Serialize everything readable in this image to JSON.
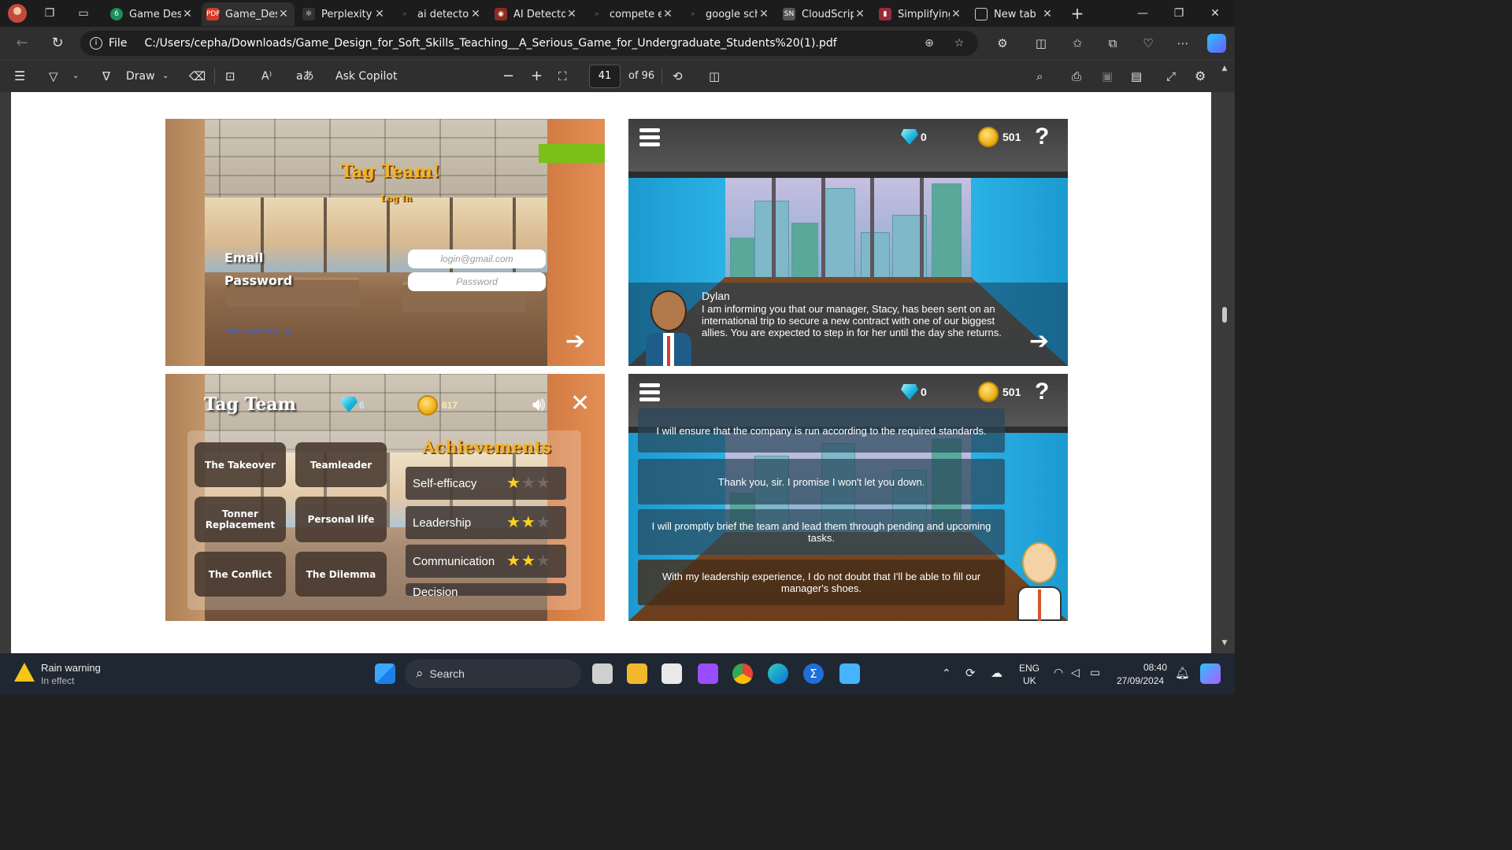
{
  "browser": {
    "tabs": [
      {
        "label": "Game Desi",
        "icon": "edge-logo-icon",
        "active": false
      },
      {
        "label": "Game_Des",
        "icon": "pdf-icon",
        "active": true
      },
      {
        "label": "Perplexity",
        "icon": "perplexity-icon",
        "active": false
      },
      {
        "label": "ai detector",
        "icon": "search-icon",
        "active": false
      },
      {
        "label": "AI Detecto",
        "icon": "ai-detector-icon",
        "active": false
      },
      {
        "label": "compete e",
        "icon": "search-icon",
        "active": false
      },
      {
        "label": "google sch",
        "icon": "search-icon",
        "active": false
      },
      {
        "label": "CloudScrip",
        "icon": "cloudscript-icon",
        "active": false
      },
      {
        "label": "Simplifying",
        "icon": "simplifying-icon",
        "active": false
      },
      {
        "label": "New tab",
        "icon": "new-tab-icon",
        "active": false
      }
    ],
    "address": {
      "scheme": "File",
      "url": "C:/Users/cepha/Downloads/Game_Design_for_Soft_Skills_Teaching__A_Serious_Game_for_Undergraduate_Students%20(1).pdf"
    }
  },
  "pdf_toolbar": {
    "draw_label": "Draw",
    "ask_copilot_label": "Ask Copilot",
    "page_current": "41",
    "page_total": "of 96"
  },
  "document": {
    "login_panel": {
      "title": "Tag Team!",
      "subtitle": "Log In",
      "email_label": "Email",
      "password_label": "Password",
      "email_placeholder": "login@gmail.com",
      "password_placeholder": "Password",
      "signup_link": "New player? Sign up"
    },
    "dialogue_panel": {
      "gems": "0",
      "coins": "501",
      "speaker": "Dylan",
      "text": "I am informing you that our manager, Stacy, has been sent on an international trip to secure a new contract with one of our biggest allies. You are expected to step in for her until the day she returns."
    },
    "menu_panel": {
      "title": "Tag Team",
      "gems": "6",
      "coins": "617",
      "scenarios": [
        "The Takeover",
        "Teamleader",
        "Tonner Replacement",
        "Personal life",
        "The Conflict",
        "The Dilemma"
      ],
      "achievements_title": "Achievements",
      "achievements": [
        {
          "name": "Self-efficacy",
          "stars": 1
        },
        {
          "name": "Leadership",
          "stars": 2
        },
        {
          "name": "Communication",
          "stars": 2
        },
        {
          "name": "Decision",
          "stars": 0
        }
      ]
    },
    "choice_panel": {
      "gems": "0",
      "coins": "501",
      "choices": [
        "I will ensure that the company is run according to the required standards.",
        "Thank you, sir. I promise I won't let you down.",
        "I will promptly brief the team and lead them through pending and upcoming tasks.",
        "With my leadership experience, I do not doubt that I'll be able to fill our manager's shoes."
      ]
    }
  },
  "taskbar": {
    "weather_title": "Rain warning",
    "weather_sub": "In effect",
    "search_label": "Search",
    "lang_top": "ENG",
    "lang_bottom": "UK",
    "time": "08:40",
    "date": "27/09/2024"
  }
}
